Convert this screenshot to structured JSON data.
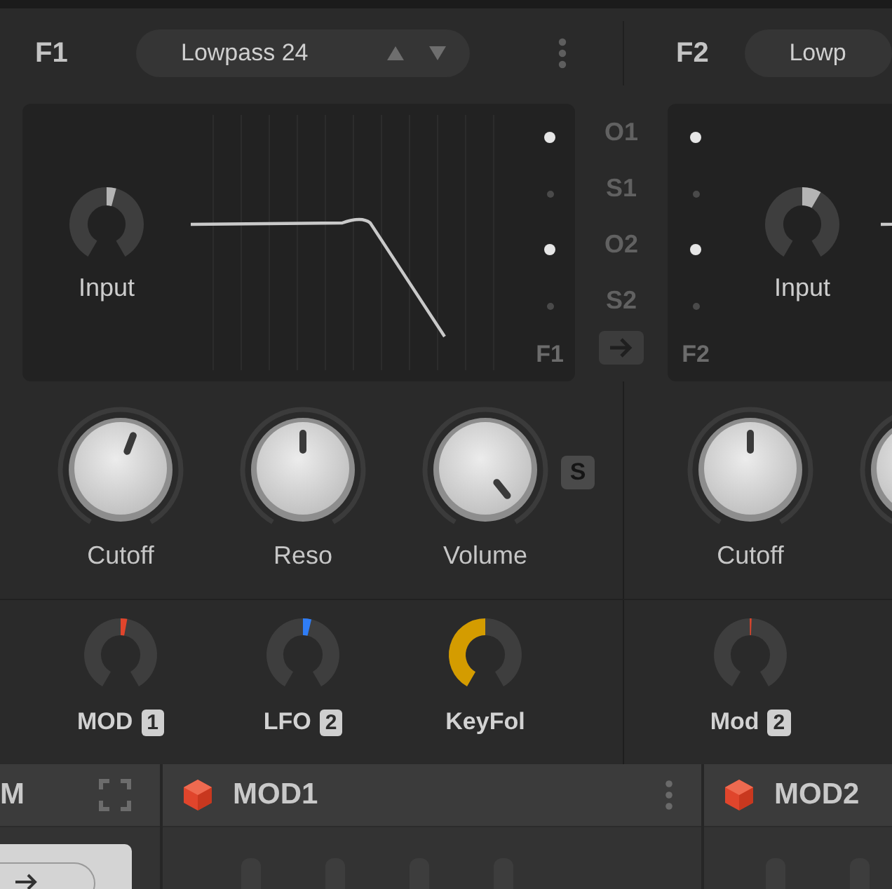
{
  "filters": [
    {
      "label": "F1",
      "preset": "Lowpass 24",
      "input": {
        "label": "Input"
      },
      "inputs": [
        {
          "on": true
        },
        {
          "on": false
        },
        {
          "on": true
        },
        {
          "on": false
        }
      ],
      "corner_label": "F1",
      "knobs": [
        {
          "kind": "knob",
          "label": "Cutoff"
        },
        {
          "kind": "knob",
          "label": "Reso"
        },
        {
          "kind": "knob",
          "label": "Volume"
        }
      ],
      "solo_label": "S",
      "mods": [
        {
          "label": "MOD",
          "badge": "1",
          "kind": "bipolar",
          "color": "#e0452c"
        },
        {
          "label": "LFO",
          "badge": "2",
          "kind": "bipolar",
          "color": "#2f7df6"
        },
        {
          "label": "KeyFol",
          "kind": "unipolar",
          "color": "#d49c00"
        }
      ]
    },
    {
      "label": "F2",
      "preset": "Lowp",
      "input": {
        "label": "Input"
      },
      "inputs": [
        {
          "on": true
        },
        {
          "on": false
        },
        {
          "on": true
        },
        {
          "on": false
        }
      ],
      "corner_label": "F2",
      "knobs": [
        {
          "kind": "knob",
          "label": "Cutoff"
        },
        {
          "kind": "cut-off"
        }
      ],
      "mods": [
        {
          "label": "Mod",
          "badge": "2",
          "kind": "bipolar",
          "color": "#e0452c"
        }
      ]
    }
  ],
  "routes": [
    "O1",
    "S1",
    "O2",
    "S2"
  ],
  "modules": [
    {
      "kind": "partial",
      "title": "M"
    },
    {
      "kind": "modulator",
      "title": "MOD1",
      "menu": true
    },
    {
      "kind": "modulator",
      "title": "MOD2",
      "menu": false
    }
  ]
}
